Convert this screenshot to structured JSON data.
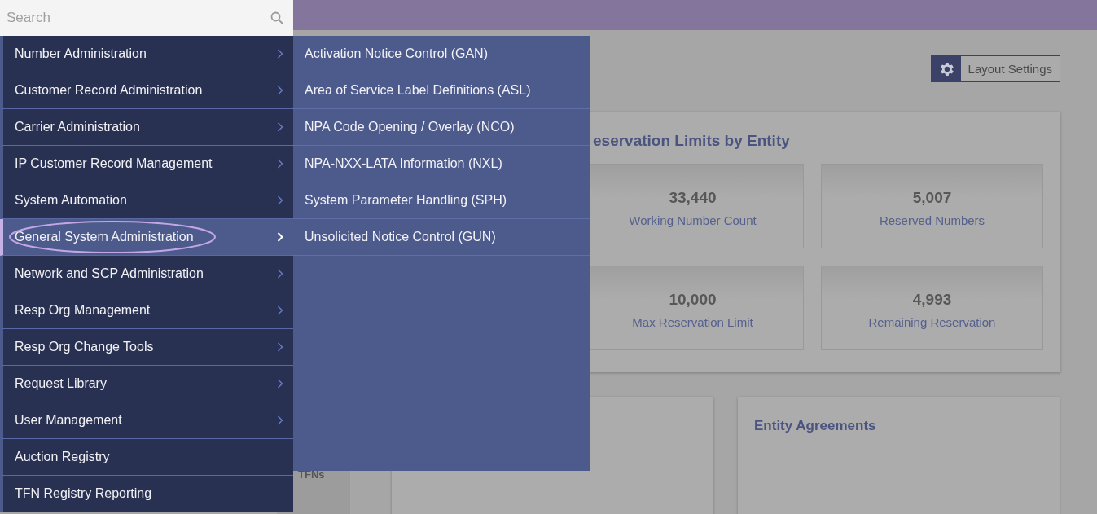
{
  "search": {
    "placeholder": "Search"
  },
  "menu": [
    {
      "label": "Number Administration",
      "submenu": true,
      "selected": false
    },
    {
      "label": "Customer Record Administration",
      "submenu": true,
      "selected": false
    },
    {
      "label": "Carrier Administration",
      "submenu": true,
      "selected": false
    },
    {
      "label": "IP Customer Record Management",
      "submenu": true,
      "selected": false
    },
    {
      "label": "System Automation",
      "submenu": true,
      "selected": false
    },
    {
      "label": "General System Administration",
      "submenu": true,
      "selected": true
    },
    {
      "label": "Network and SCP Administration",
      "submenu": true,
      "selected": false
    },
    {
      "label": "Resp Org Management",
      "submenu": true,
      "selected": false
    },
    {
      "label": "Resp Org Change Tools",
      "submenu": true,
      "selected": false
    },
    {
      "label": "Request Library",
      "submenu": true,
      "selected": false
    },
    {
      "label": "User Management",
      "submenu": true,
      "selected": false
    },
    {
      "label": "Auction Registry",
      "submenu": false,
      "selected": false
    },
    {
      "label": "TFN Registry Reporting",
      "submenu": false,
      "selected": false
    }
  ],
  "submenu": [
    "Activation Notice Control (GAN)",
    "Area of Service Label Definitions (ASL)",
    "NPA Code Opening / Overlay (NCO)",
    "NPA-NXX-LATA Information (NXL)",
    "System Parameter Handling (SPH)",
    "Unsolicited Notice Control (GUN)"
  ],
  "layout_button": "Layout Settings",
  "limits_card": {
    "title": "eservation Limits by Entity",
    "stats": [
      {
        "value": "33,440",
        "label": "Working Number Count"
      },
      {
        "value": "5,007",
        "label": "Reserved Numbers"
      },
      {
        "value": "10,000",
        "label": "Max Reservation Limit"
      },
      {
        "value": "4,993",
        "label": "Remaining Reservation"
      }
    ]
  },
  "side_card": {
    "text": "TFNs"
  },
  "agreements_card": {
    "title": "Entity Agreements"
  }
}
